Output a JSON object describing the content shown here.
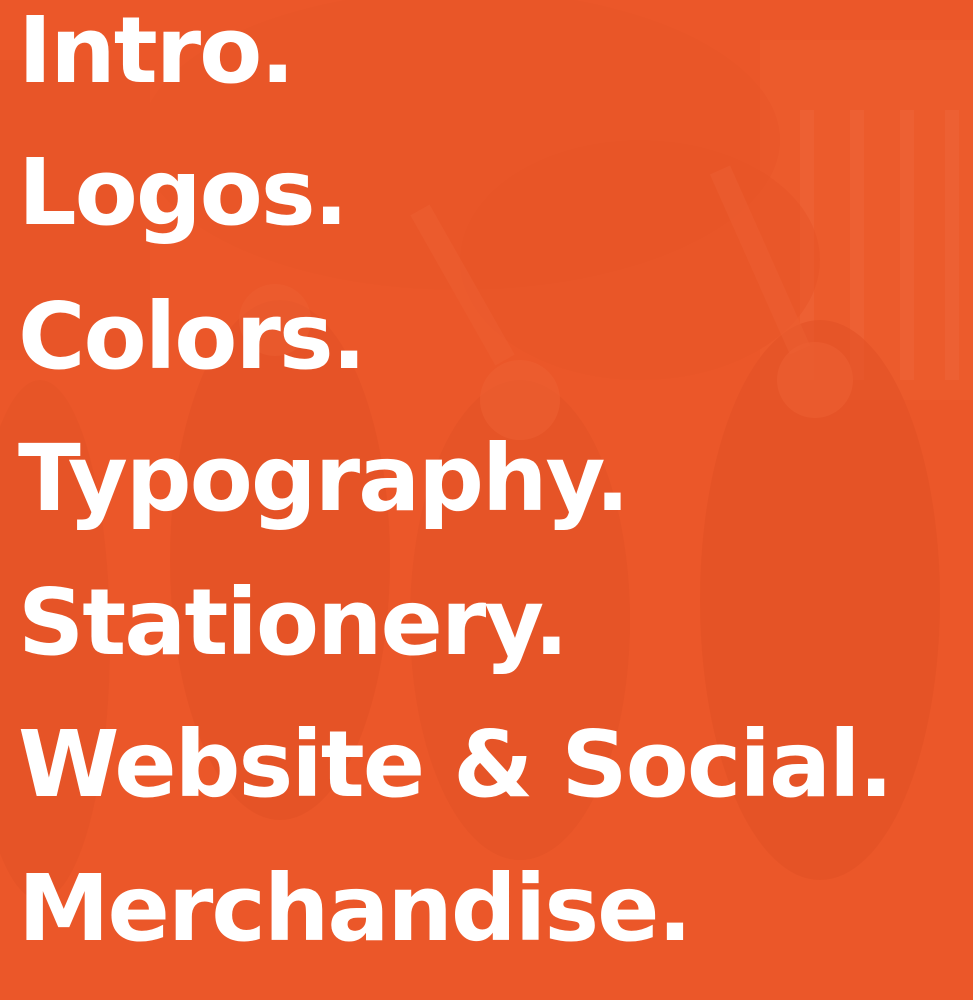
{
  "theme": {
    "overlay_color": "#ea5527",
    "text_color": "#ffffff"
  },
  "background": {
    "subject": "graduates-celebrating-photo"
  },
  "menu": {
    "items": [
      {
        "label": "Intro."
      },
      {
        "label": "Logos."
      },
      {
        "label": "Colors."
      },
      {
        "label": "Typography."
      },
      {
        "label": "Stationery."
      },
      {
        "label": "Website & Social."
      },
      {
        "label": "Merchandise."
      }
    ]
  }
}
